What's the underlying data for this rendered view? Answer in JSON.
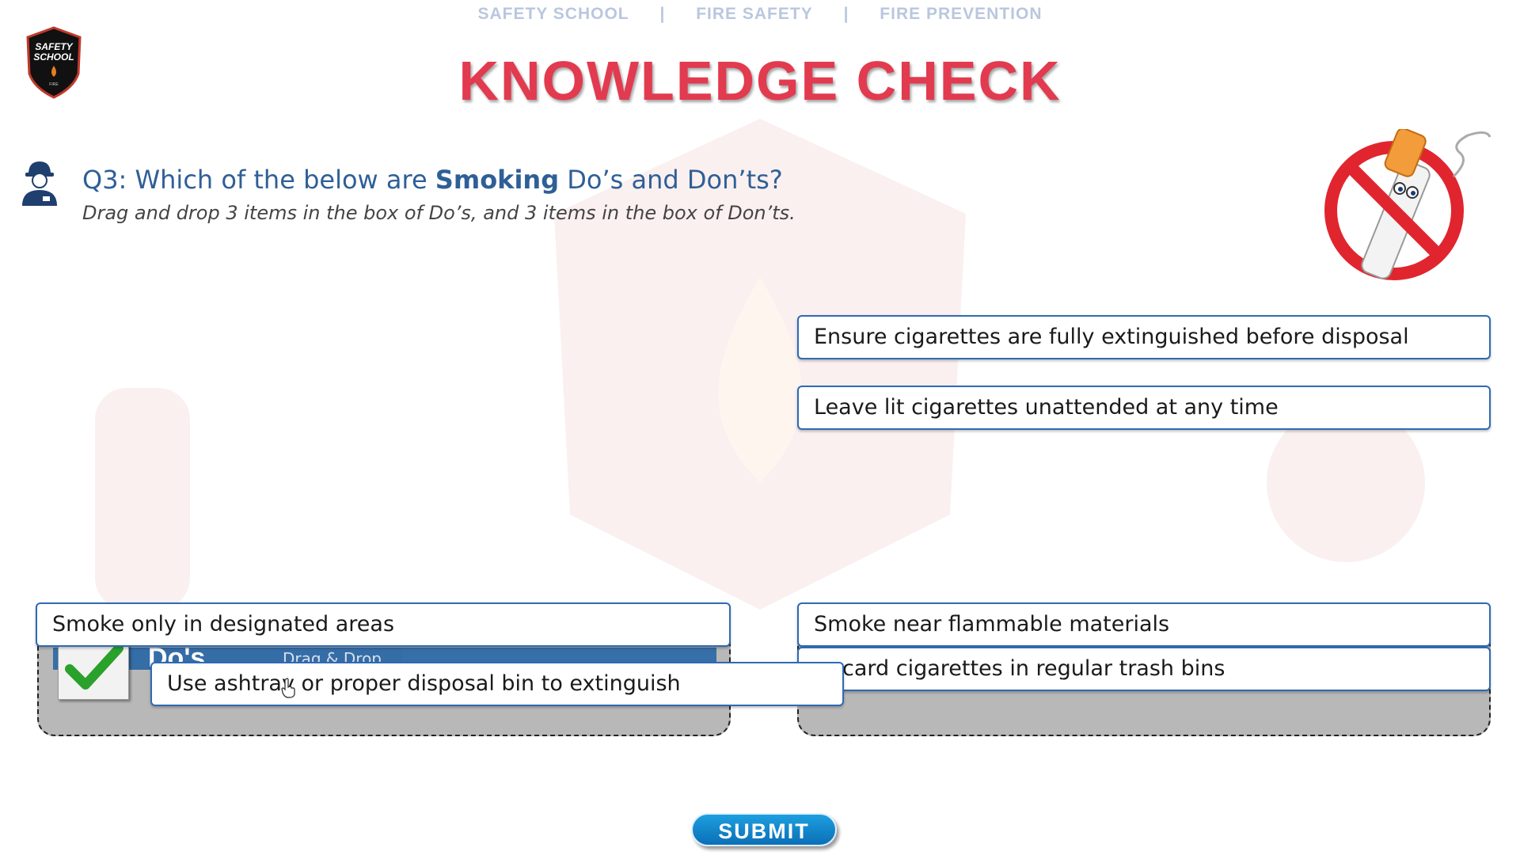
{
  "nav": {
    "items": [
      "SAFETY SCHOOL",
      "FIRE SAFETY",
      "FIRE PREVENTION"
    ],
    "separator": "|"
  },
  "logo": {
    "line1": "SAFETY",
    "line2": "SCHOOL",
    "line3": "FIRE"
  },
  "page_title": "KNOWLEDGE CHECK",
  "question": {
    "prefix": "Q3: Which of the below are ",
    "emphasis": "Smoking",
    "suffix": " Do’s and Don’ts?",
    "instruction": "Drag and drop 3 items in the box of Do’s, and 3 items in the box of Don’ts."
  },
  "drop_zones": {
    "dos": {
      "label": "Do's",
      "sub": "Drag & Drop"
    }
  },
  "cards": [
    {
      "text": "Ensure cigarettes are fully extinguished before disposal"
    },
    {
      "text": "Leave lit cigarettes unattended at any time"
    },
    {
      "text": "Smoke only in designated areas"
    },
    {
      "text": "Smoke near flammable materials"
    },
    {
      "text": "card cigarettes in regular trash bins"
    },
    {
      "text": "Use ashtray or proper disposal bin to extinguish"
    }
  ],
  "submit_label": "SUBMIT",
  "colors": {
    "title": "#e23a4f",
    "question": "#2f5f97",
    "card_border": "#2f6ab4",
    "submit": "#1d9fe0",
    "drop_zone_bg": "#b8b8b8"
  },
  "icons": [
    "safety-school-logo-icon",
    "firefighter-icon",
    "no-smoking-icon",
    "checkmark-icon",
    "hand-cursor-icon"
  ]
}
